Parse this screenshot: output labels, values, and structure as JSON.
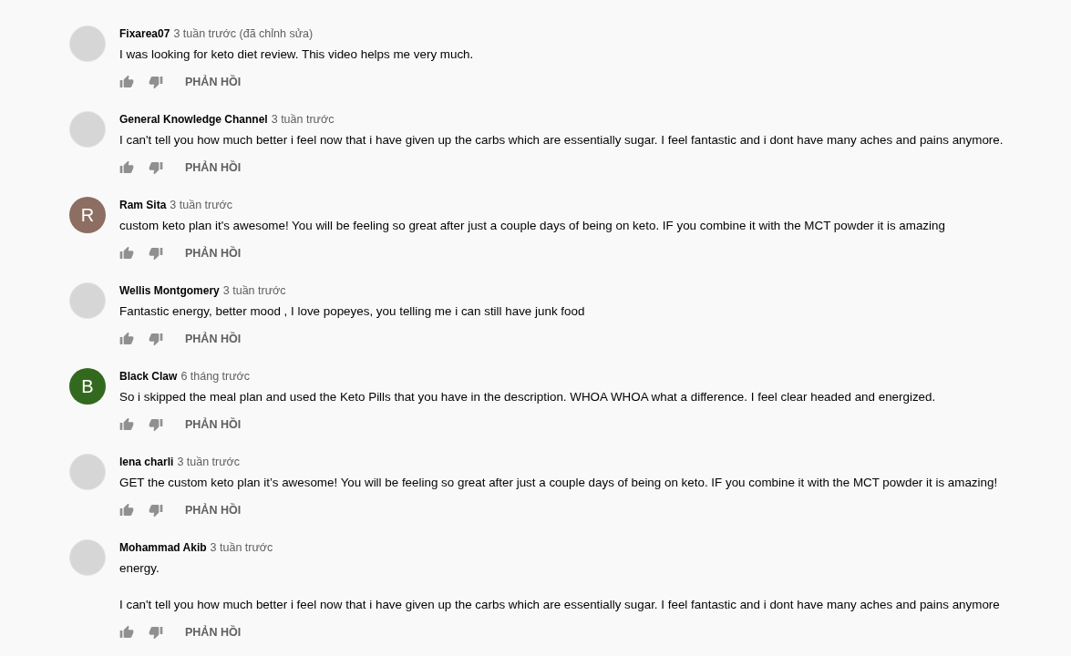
{
  "comments": [
    {
      "author": "Fixarea07",
      "time": "3 tuần trước (đã chỉnh sửa)",
      "avatar": {
        "kind": "image"
      },
      "paragraphs": [
        "I was looking for keto diet review. This video helps me very much."
      ],
      "reply": "PHẢN HỒI"
    },
    {
      "author": "General Knowledge Channel",
      "time": "3 tuần trước",
      "avatar": {
        "kind": "image"
      },
      "paragraphs": [
        "I can't tell you how much  better i feel now that i have given up the carbs which are essentially sugar. I feel fantastic and i dont have many aches and pains anymore."
      ],
      "reply": "PHẢN HỒI"
    },
    {
      "author": "Ram Sita",
      "time": "3 tuần trước",
      "avatar": {
        "kind": "letter",
        "letter": "R",
        "color": "#8d6e63"
      },
      "paragraphs": [
        "custom keto plan it's awesome! You will be feeling so great after just a couple days of being on keto. IF you combine it with the MCT powder it is amazing"
      ],
      "reply": "PHẢN HỒI"
    },
    {
      "author": "Wellis Montgomery",
      "time": "3 tuần trước",
      "avatar": {
        "kind": "image"
      },
      "paragraphs": [
        "Fantastic energy, better mood , I love popeyes, you telling me i can still have junk food"
      ],
      "reply": "PHẢN HỒI"
    },
    {
      "author": "Black Claw",
      "time": "6 tháng trước",
      "avatar": {
        "kind": "letter",
        "letter": "B",
        "color": "#33691e"
      },
      "paragraphs": [
        "So i skipped the meal plan and used the Keto Pills that you have in the description. WHOA WHOA what a difference. I feel clear headed and energized."
      ],
      "reply": "PHẢN HỒI"
    },
    {
      "author": "lena charli",
      "time": "3 tuần trước",
      "avatar": {
        "kind": "image"
      },
      "paragraphs": [
        "GET the custom keto plan it’s awesome! You will be feeling so great after just a couple days of being on keto. IF you combine it with the MCT powder it is amazing!"
      ],
      "reply": "PHẢN HỒI"
    },
    {
      "author": "Mohammad Akib",
      "time": "3 tuần trước",
      "avatar": {
        "kind": "image"
      },
      "paragraphs": [
        "energy.",
        "I can't tell you how much  better i feel now that i have given up the carbs which are essentially sugar. I feel fantastic and i dont have many aches and pains anymore"
      ],
      "reply": "PHẢN HỒI"
    }
  ]
}
